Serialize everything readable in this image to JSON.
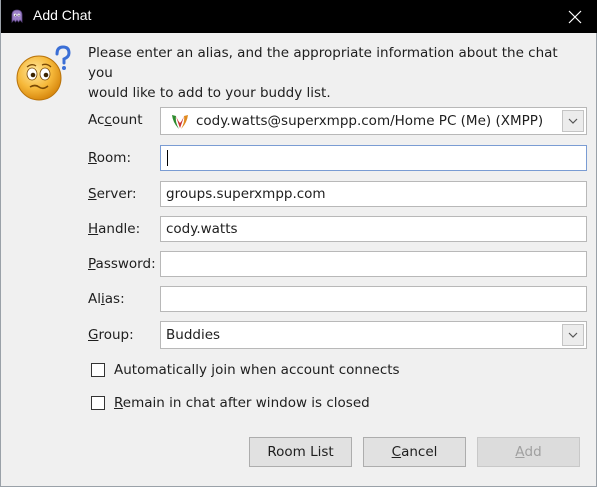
{
  "window": {
    "title": "Add Chat",
    "close_glyph": "✕"
  },
  "intro": {
    "line1": "Please enter an alias, and the appropriate information about the chat you",
    "line2": "would like to add to your buddy list."
  },
  "labels": {
    "account": {
      "pre": "Ac",
      "key": "c",
      "post": "ount"
    },
    "room": {
      "pre": "",
      "key": "R",
      "post": "oom:"
    },
    "server": {
      "pre": "",
      "key": "S",
      "post": "erver:"
    },
    "handle": {
      "pre": "",
      "key": "H",
      "post": "andle:"
    },
    "password": {
      "pre": "",
      "key": "P",
      "post": "assword:"
    },
    "alias": {
      "pre": "Al",
      "key": "i",
      "post": "as:"
    },
    "group": {
      "pre": "",
      "key": "G",
      "post": "roup:"
    }
  },
  "fields": {
    "account": {
      "value": "cody.watts@superxmpp.com/Home PC (Me) (XMPP)",
      "icon": "xmpp-protocol-icon"
    },
    "room": {
      "value": ""
    },
    "server": {
      "value": "groups.superxmpp.com"
    },
    "handle": {
      "value": "cody.watts"
    },
    "password": {
      "value": ""
    },
    "alias": {
      "value": ""
    },
    "group": {
      "value": "Buddies"
    }
  },
  "checkboxes": {
    "autojoin": {
      "pre": "Automatically ",
      "key": "j",
      "post": "oin when account connects",
      "checked": false
    },
    "remain": {
      "pre": "",
      "key": "R",
      "post": "emain in chat after window is closed",
      "checked": false
    }
  },
  "buttons": {
    "room_list": {
      "pre": "Room List",
      "key": "",
      "post": ""
    },
    "cancel": {
      "pre": "",
      "key": "C",
      "post": "ancel"
    },
    "add": {
      "pre": "",
      "key": "A",
      "post": "dd",
      "disabled": true
    }
  },
  "colors": {
    "titlebar": "#000000",
    "background": "#f0f0f0",
    "disabled_text": "#a0a0a0"
  }
}
